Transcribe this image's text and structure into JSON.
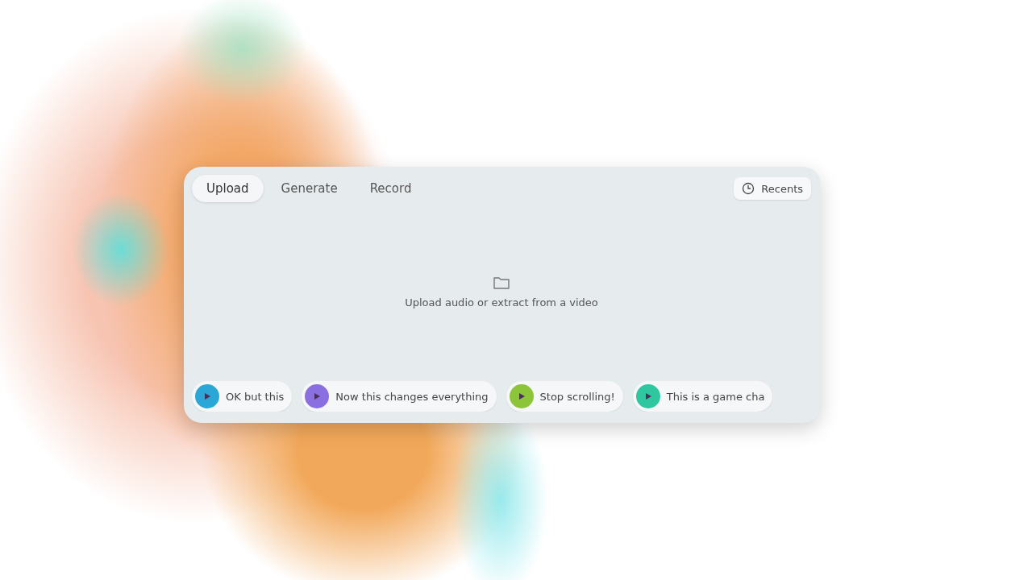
{
  "tabs": [
    {
      "label": "Upload",
      "selected": true
    },
    {
      "label": "Generate",
      "selected": false
    },
    {
      "label": "Record",
      "selected": false
    }
  ],
  "recents_button": {
    "label": "Recents"
  },
  "dropzone": {
    "text": "Upload audio or extract from a video"
  },
  "samples": [
    {
      "label": "OK but this",
      "color": "#2aa7d6"
    },
    {
      "label": "Now this changes everything",
      "color": "#8a6fe0"
    },
    {
      "label": "Stop scrolling!",
      "color": "#8cc43a"
    },
    {
      "label": "This is a game cha",
      "color": "#2fc7a0"
    }
  ]
}
